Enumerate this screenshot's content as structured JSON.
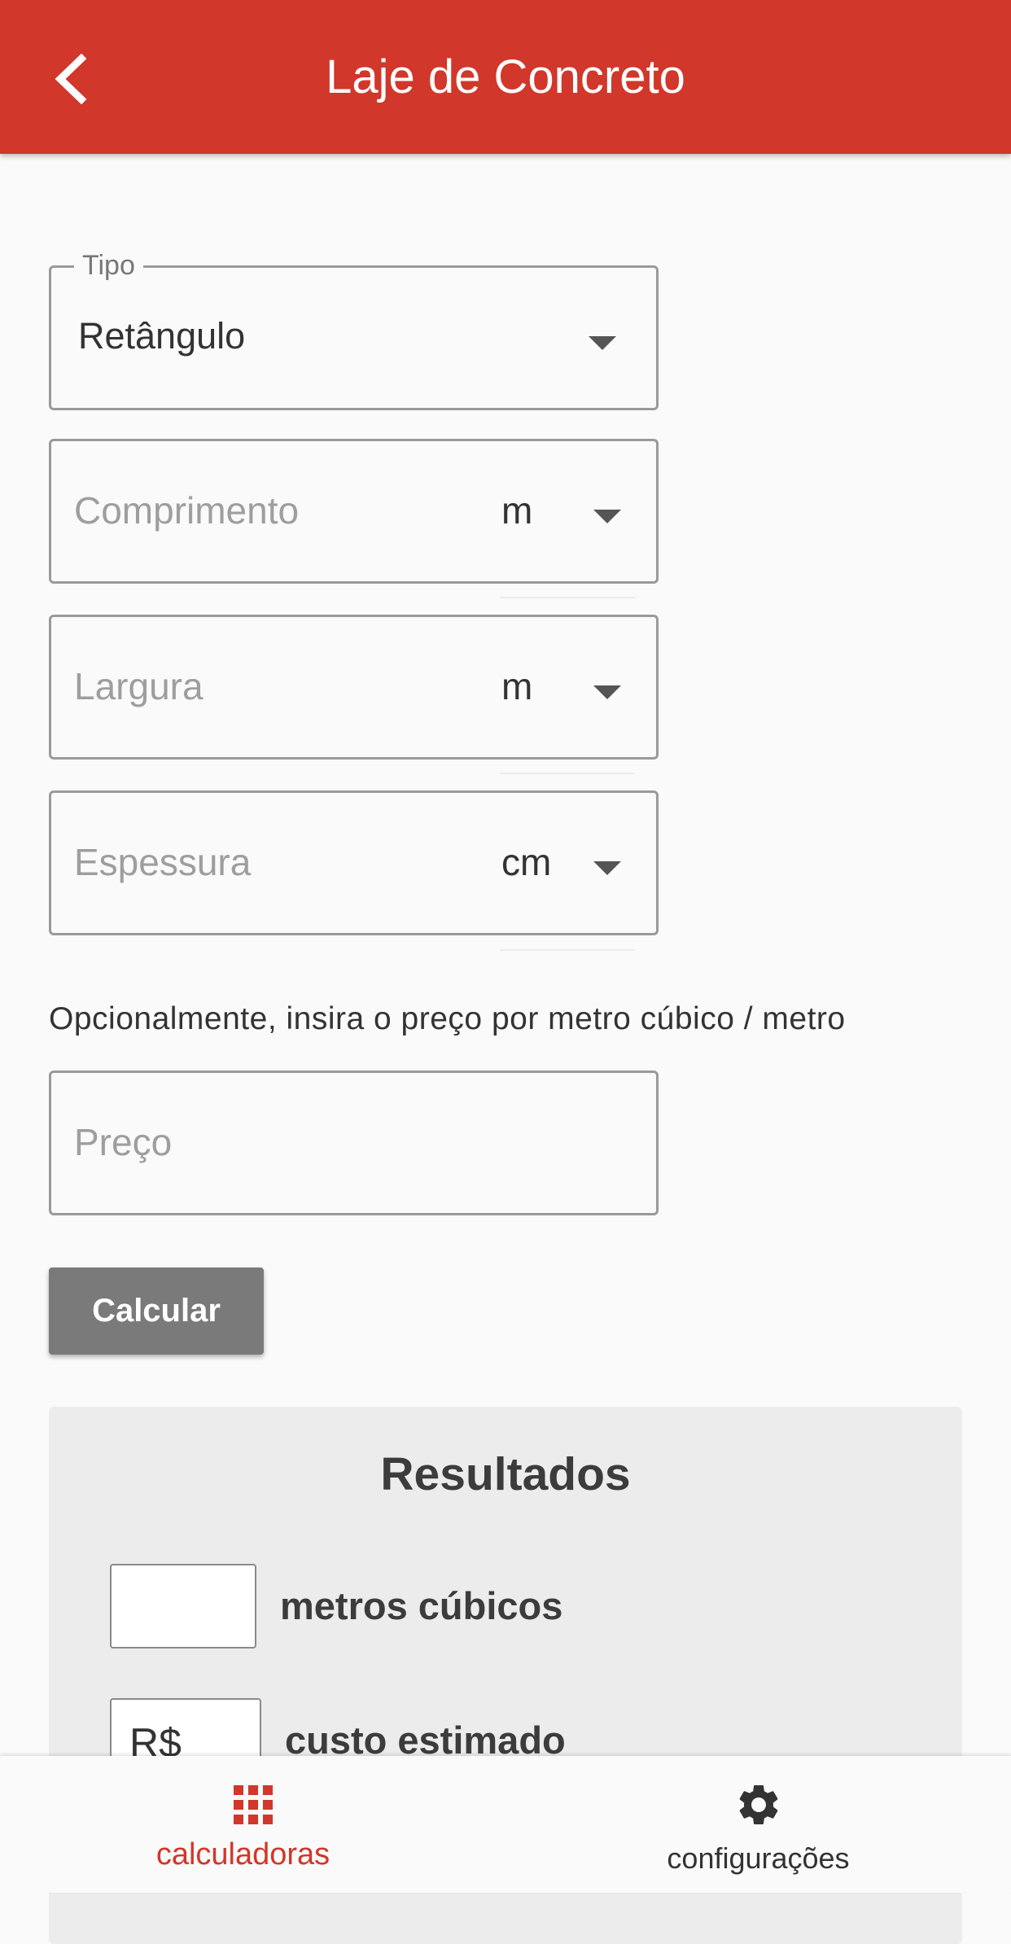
{
  "app_bar": {
    "title": "Laje de Concreto",
    "back_icon": "chevron-left-icon",
    "color": "#d1372a"
  },
  "form": {
    "tipo": {
      "label": "Tipo",
      "value": "Retângulo"
    },
    "comprimento": {
      "placeholder": "Comprimento",
      "unit": "m"
    },
    "largura": {
      "placeholder": "Largura",
      "unit": "m"
    },
    "espessura": {
      "placeholder": "Espessura",
      "unit": "cm"
    },
    "price_hint": "Opcionalmente, insira o preço por metro cúbico / metro",
    "preco": {
      "placeholder": "Preço"
    },
    "calculate_label": "Calcular"
  },
  "results": {
    "title": "Resultados",
    "volume": {
      "value": "",
      "label": "metros cúbicos"
    },
    "cost": {
      "value": "R$",
      "label": "custo estimado"
    }
  },
  "bottom_nav": {
    "items": [
      {
        "label": "calculadoras",
        "icon": "grid-icon",
        "active": true
      },
      {
        "label": "configurações",
        "icon": "gear-icon",
        "active": false
      }
    ],
    "active_color": "#d1372a",
    "inactive_color": "#333333"
  }
}
